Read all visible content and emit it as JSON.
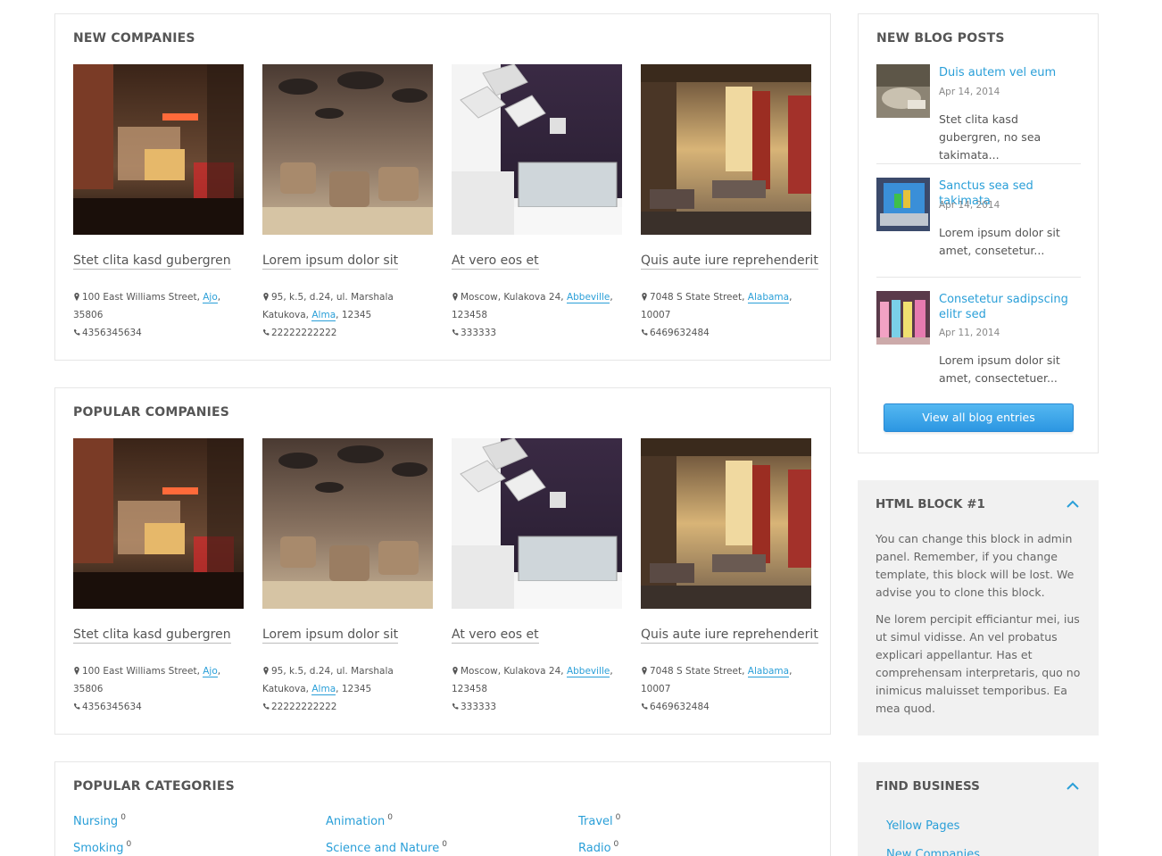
{
  "new_companies": {
    "title": "NEW COMPANIES",
    "items": [
      {
        "name": "Stet clita kasd gubergren",
        "address": "100 East Williams Street,",
        "city": "Ajo",
        "zip": "35806",
        "phone": "4356345634"
      },
      {
        "name": "Lorem ipsum dolor sit",
        "address": "95, k.5, d.24, ul. Marshala Katukova,",
        "city": "Alma",
        "zip": "12345",
        "phone": "22222222222"
      },
      {
        "name": "At vero eos et",
        "address": "Moscow, Kulakova 24,",
        "city": "Abbeville",
        "zip": "123458",
        "phone": "333333"
      },
      {
        "name": "Quis aute iure reprehenderit",
        "address": "7048 S State Street,",
        "city": "Alabama",
        "zip": "10007",
        "phone": "6469632484"
      }
    ]
  },
  "popular_companies": {
    "title": "POPULAR COMPANIES",
    "items": [
      {
        "name": "Stet clita kasd gubergren",
        "address": "100 East Williams Street,",
        "city": "Ajo",
        "zip": "35806",
        "phone": "4356345634"
      },
      {
        "name": "Lorem ipsum dolor sit",
        "address": "95, k.5, d.24, ul. Marshala Katukova,",
        "city": "Alma",
        "zip": "12345",
        "phone": "22222222222"
      },
      {
        "name": "At vero eos et",
        "address": "Moscow, Kulakova 24,",
        "city": "Abbeville",
        "zip": "123458",
        "phone": "333333"
      },
      {
        "name": "Quis aute iure reprehenderit",
        "address": "7048 S State Street,",
        "city": "Alabama",
        "zip": "10007",
        "phone": "6469632484"
      }
    ]
  },
  "popular_categories": {
    "title": "POPULAR CATEGORIES",
    "items": [
      {
        "label": "Nursing",
        "count": "0"
      },
      {
        "label": "Animation",
        "count": "0"
      },
      {
        "label": "Travel",
        "count": "0"
      },
      {
        "label": "Smoking",
        "count": "0"
      },
      {
        "label": "Science and Nature",
        "count": "0"
      },
      {
        "label": "Radio",
        "count": "0"
      }
    ]
  },
  "blog": {
    "title": "NEW BLOG POSTS",
    "posts": [
      {
        "title": "Duis autem vel eum",
        "date": "Apr 14, 2014",
        "excerpt": "Stet clita kasd gubergren, no sea takimata..."
      },
      {
        "title": "Sanctus sea sed takimata",
        "date": "Apr 14, 2014",
        "excerpt": "Lorem ipsum dolor sit amet, consetetur..."
      },
      {
        "title": "Consetetur sadipscing elitr sed",
        "date": "Apr 11, 2014",
        "excerpt": "Lorem ipsum dolor sit amet, consectetuer..."
      }
    ],
    "button_label": "View all blog entries"
  },
  "html_block": {
    "title": "HTML BLOCK #1",
    "para1": "You can change this block in admin panel. Remember, if you change template, this block will be lost. We advise you to clone this block.",
    "para2": "Ne lorem percipit efficiantur mei, ius ut simul vidisse. An vel probatus explicari appellantur. Has et comprehensam interpretaris, quo no inimicus maluisset temporibus. Ea mea quod."
  },
  "find_business": {
    "title": "FIND BUSINESS",
    "links": [
      "Yellow Pages",
      "New Companies"
    ]
  },
  "colors": {
    "link": "#2a9fd8",
    "heading": "#555555",
    "button": "#3aa6ec"
  }
}
